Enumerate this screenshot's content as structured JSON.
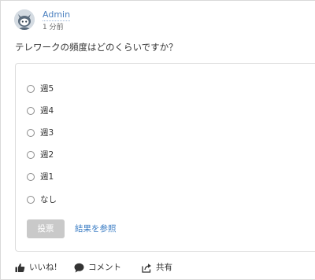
{
  "post": {
    "author": "Admin",
    "timestamp": "1 分前",
    "question": "テレワークの頻度はどのくらいですか？"
  },
  "poll": {
    "options": [
      {
        "label": "週5"
      },
      {
        "label": "週4"
      },
      {
        "label": "週3"
      },
      {
        "label": "週2"
      },
      {
        "label": "週1"
      },
      {
        "label": "なし"
      }
    ],
    "vote_label": "投票",
    "results_label": "結果を参照"
  },
  "actions": {
    "like_label": "いいね!",
    "comment_label": "コメント",
    "share_label": "共有"
  },
  "icons": {
    "avatar": "robot-avatar-icon",
    "like": "thumbs-up-icon",
    "comment": "speech-bubble-icon",
    "share": "share-arrow-icon"
  },
  "colors": {
    "link": "#4a7fbf",
    "vote_button_disabled": "#c9c9c9",
    "card_border": "#dcdcdc"
  }
}
